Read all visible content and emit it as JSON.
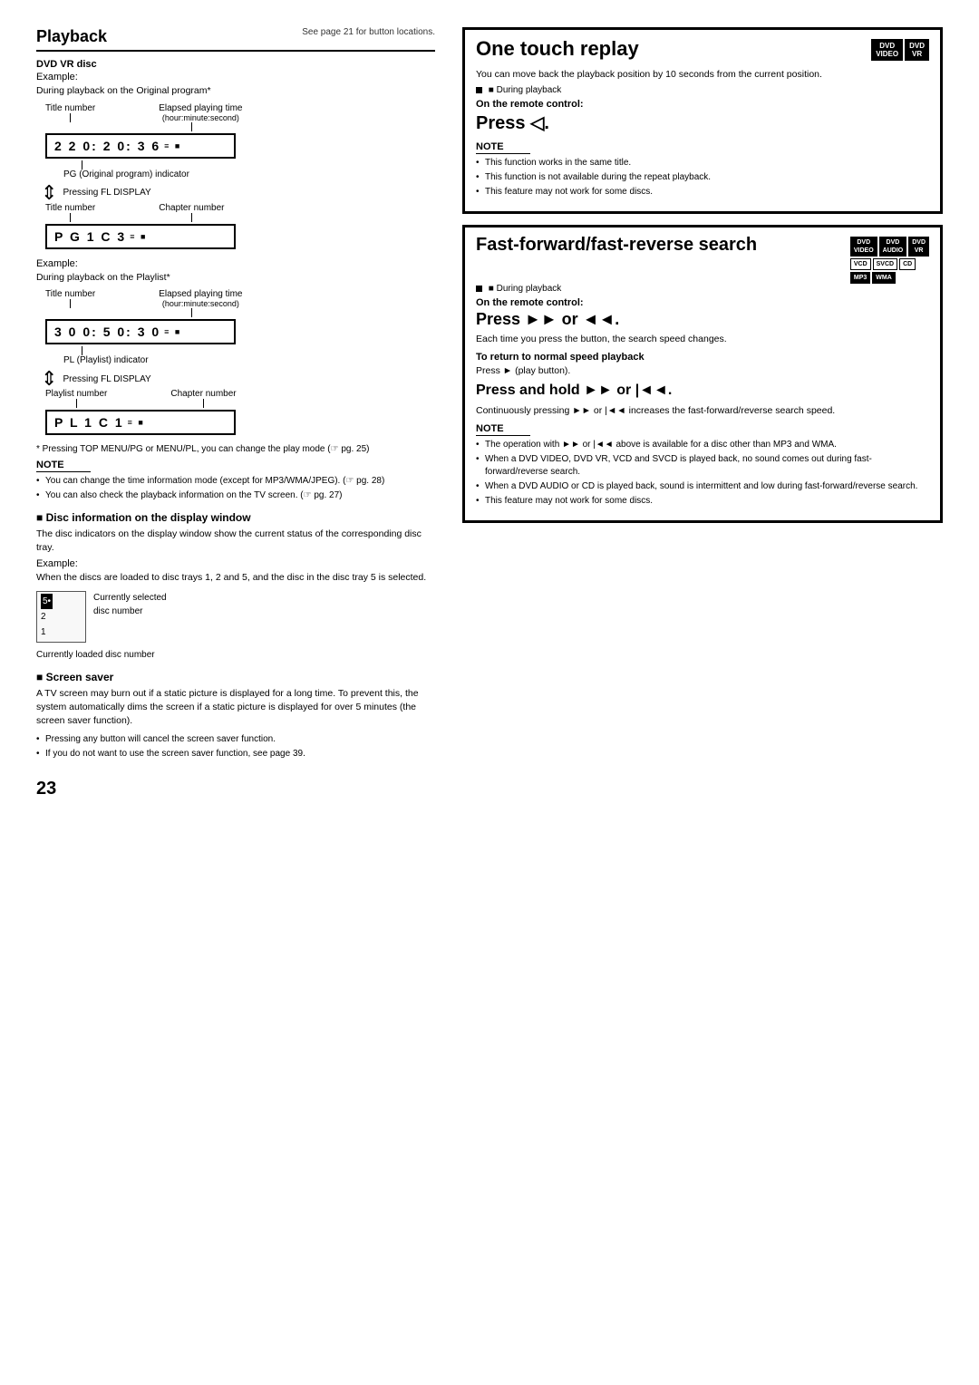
{
  "page": {
    "number": "23",
    "header_right": "See page 21 for button locations."
  },
  "left": {
    "section_title": "Playback",
    "dvd_vr_disc_label": "DVD VR disc",
    "example1_label": "Example:",
    "example1_desc": "During playback on the Original program*",
    "title_number_label": "Title number",
    "elapsed_label": "Elapsed playing time",
    "elapsed_sub": "(hour:minute:second)",
    "display1_content": "2  2    0: 2  0: 3  6",
    "display1_icons": "≡ ■",
    "pg_indicator": "PG (Original program) indicator",
    "pressing_fl": "Pressing FL DISPLAY",
    "title_number_label2": "Title number",
    "chapter_number_label": "Chapter number",
    "display2_content": "P G   1 C   3",
    "display2_icons": "≡ ■",
    "example2_label": "Example:",
    "example2_desc": "During playback on the Playlist*",
    "title_number_label3": "Title number",
    "elapsed_label2": "Elapsed playing time",
    "elapsed_sub2": "(hour:minute:second)",
    "display3_content": "3  0    0: 5  0: 3  0",
    "display3_icons": "≡ ■",
    "pl_indicator": "PL (Playlist) indicator",
    "pressing_fl2": "Pressing FL DISPLAY",
    "playlist_number_label": "Playlist number",
    "chapter_number_label2": "Chapter number",
    "display4_content": "P L   1 C   1",
    "display4_icons": "≡ ■",
    "asterisk_note": "* Pressing TOP MENU/PG or MENU/PL, you can change the play mode (☞ pg. 25)",
    "note_title": "NOTE",
    "note_items": [
      "You can change the time information mode (except for MP3/WMA/JPEG). (☞ pg. 28)",
      "You can also check the playback information on the TV screen. (☞ pg. 27)"
    ],
    "disc_info_title": "■ Disc information on the display window",
    "disc_info_desc": "The disc indicators on the display window show the current status of the corresponding disc tray.",
    "disc_info_example_label": "Example:",
    "disc_info_example_desc": "When the discs are loaded to disc trays 1, 2 and 5, and the disc in the disc tray 5 is selected.",
    "disc_tray_items": [
      "5•",
      "2",
      "1"
    ],
    "disc_tray_selected": "5•",
    "currently_selected_label": "Currently selected",
    "disc_number_label": "disc number",
    "currently_loaded_label": "Currently loaded disc number",
    "screen_saver_title": "■ Screen saver",
    "screen_saver_desc": "A TV screen may burn out if a static picture is displayed for a long time. To prevent this, the system automatically dims the screen if a static picture is displayed for over 5 minutes (the screen saver function).",
    "screen_saver_notes": [
      "Pressing any button will cancel the screen saver function.",
      "If you do not want to use the screen saver function, see page 39."
    ]
  },
  "right": {
    "one_touch_section": {
      "title": "One touch replay",
      "desc": "You can move back the playback position by 10 seconds from the current position.",
      "badges_top": [
        "DVD VIDEO",
        "DVD VR"
      ],
      "during_playback": "■ During playback",
      "on_remote": "On the remote control:",
      "press_instruction": "Press ◁.",
      "note_title": "NOTE",
      "note_items": [
        "This function works in the same title.",
        "This function is not available during the repeat playback.",
        "This feature may not work for some discs."
      ]
    },
    "fast_forward_section": {
      "title": "Fast-forward/fast-reverse search",
      "during_playback": "■ During playback",
      "badges_top": [
        "DVD VIDEO",
        "DVD AUDIO",
        "DVD VR",
        "VCD",
        "SVCD",
        "CD",
        "MP3",
        "WMA"
      ],
      "on_remote": "On the remote control:",
      "press_instruction": "Press ►► or ◄◄.",
      "press_desc": "Each time you press the button, the search speed changes.",
      "to_return_title": "To return to normal speed playback",
      "to_return_desc": "Press ► (play button).",
      "press_hold_title": "Press and hold ►► or |◄◄.",
      "press_hold_desc": "Continuously pressing ►► or |◄◄ increases the fast-forward/reverse search speed.",
      "note_title": "NOTE",
      "note_items": [
        "The operation with ►► or |◄◄ above is available for a disc other than MP3 and WMA.",
        "When a DVD VIDEO, DVD VR, VCD and SVCD is played back, no sound comes out during fast-forward/reverse search.",
        "When a DVD AUDIO or CD is played back, sound is intermittent and low during fast-forward/reverse search.",
        "This feature may not work for some discs."
      ]
    }
  }
}
